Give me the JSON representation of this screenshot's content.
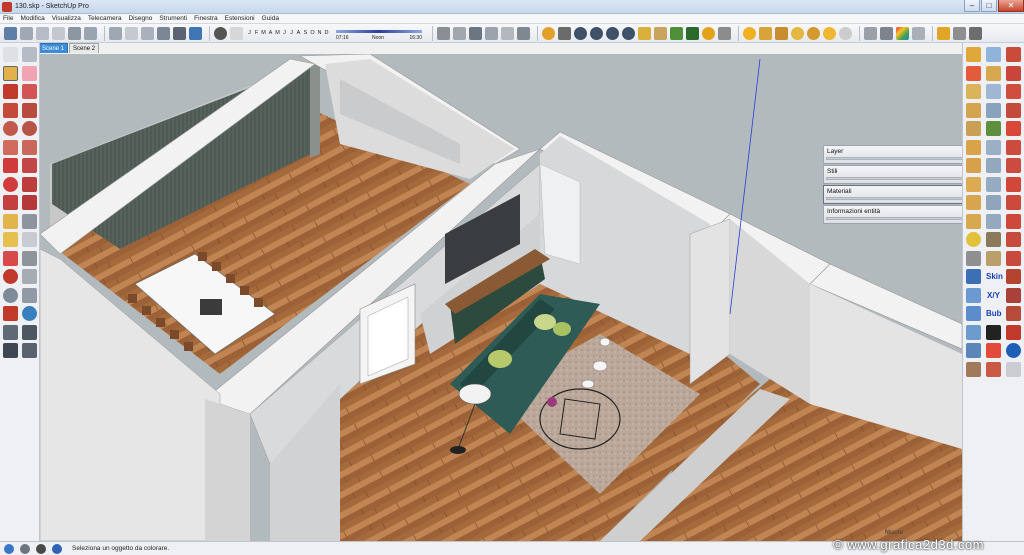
{
  "window": {
    "title": "130.skp - SketchUp Pro",
    "minimize": "–",
    "maximize": "□",
    "close": "✕"
  },
  "menu": [
    "File",
    "Modifica",
    "Visualizza",
    "Telecamera",
    "Disegno",
    "Strumenti",
    "Finestra",
    "Estensioni",
    "Guida"
  ],
  "shadow": {
    "months": [
      "J",
      "F",
      "M",
      "A",
      "M",
      "J",
      "J",
      "A",
      "S",
      "O",
      "N",
      "D"
    ],
    "time_start": "07:16",
    "time_mid": "Noon",
    "time_end": "16:30"
  },
  "scenes": [
    {
      "label": "Scene 1",
      "active": true
    },
    {
      "label": "Scene 2",
      "active": false
    }
  ],
  "tray": {
    "panels": [
      {
        "label": "Layer",
        "selected": false
      },
      {
        "label": "Stili",
        "selected": false
      },
      {
        "label": "Materiali",
        "selected": true
      },
      {
        "label": "Informazioni entità",
        "selected": false
      }
    ]
  },
  "plugin_labels": {
    "skin": "Skin",
    "xyz": "X/Y",
    "bub": "Bub"
  },
  "status": {
    "message": "Seleziona un oggetto da colorare.",
    "measure_label": "Misure"
  },
  "watermark": "© www.grafica2d3d.com",
  "colors": {
    "accent": "#3b8bd6",
    "floor": "#b57a44",
    "wall": "#e6e6e6",
    "sky": "#b2b9bd"
  }
}
